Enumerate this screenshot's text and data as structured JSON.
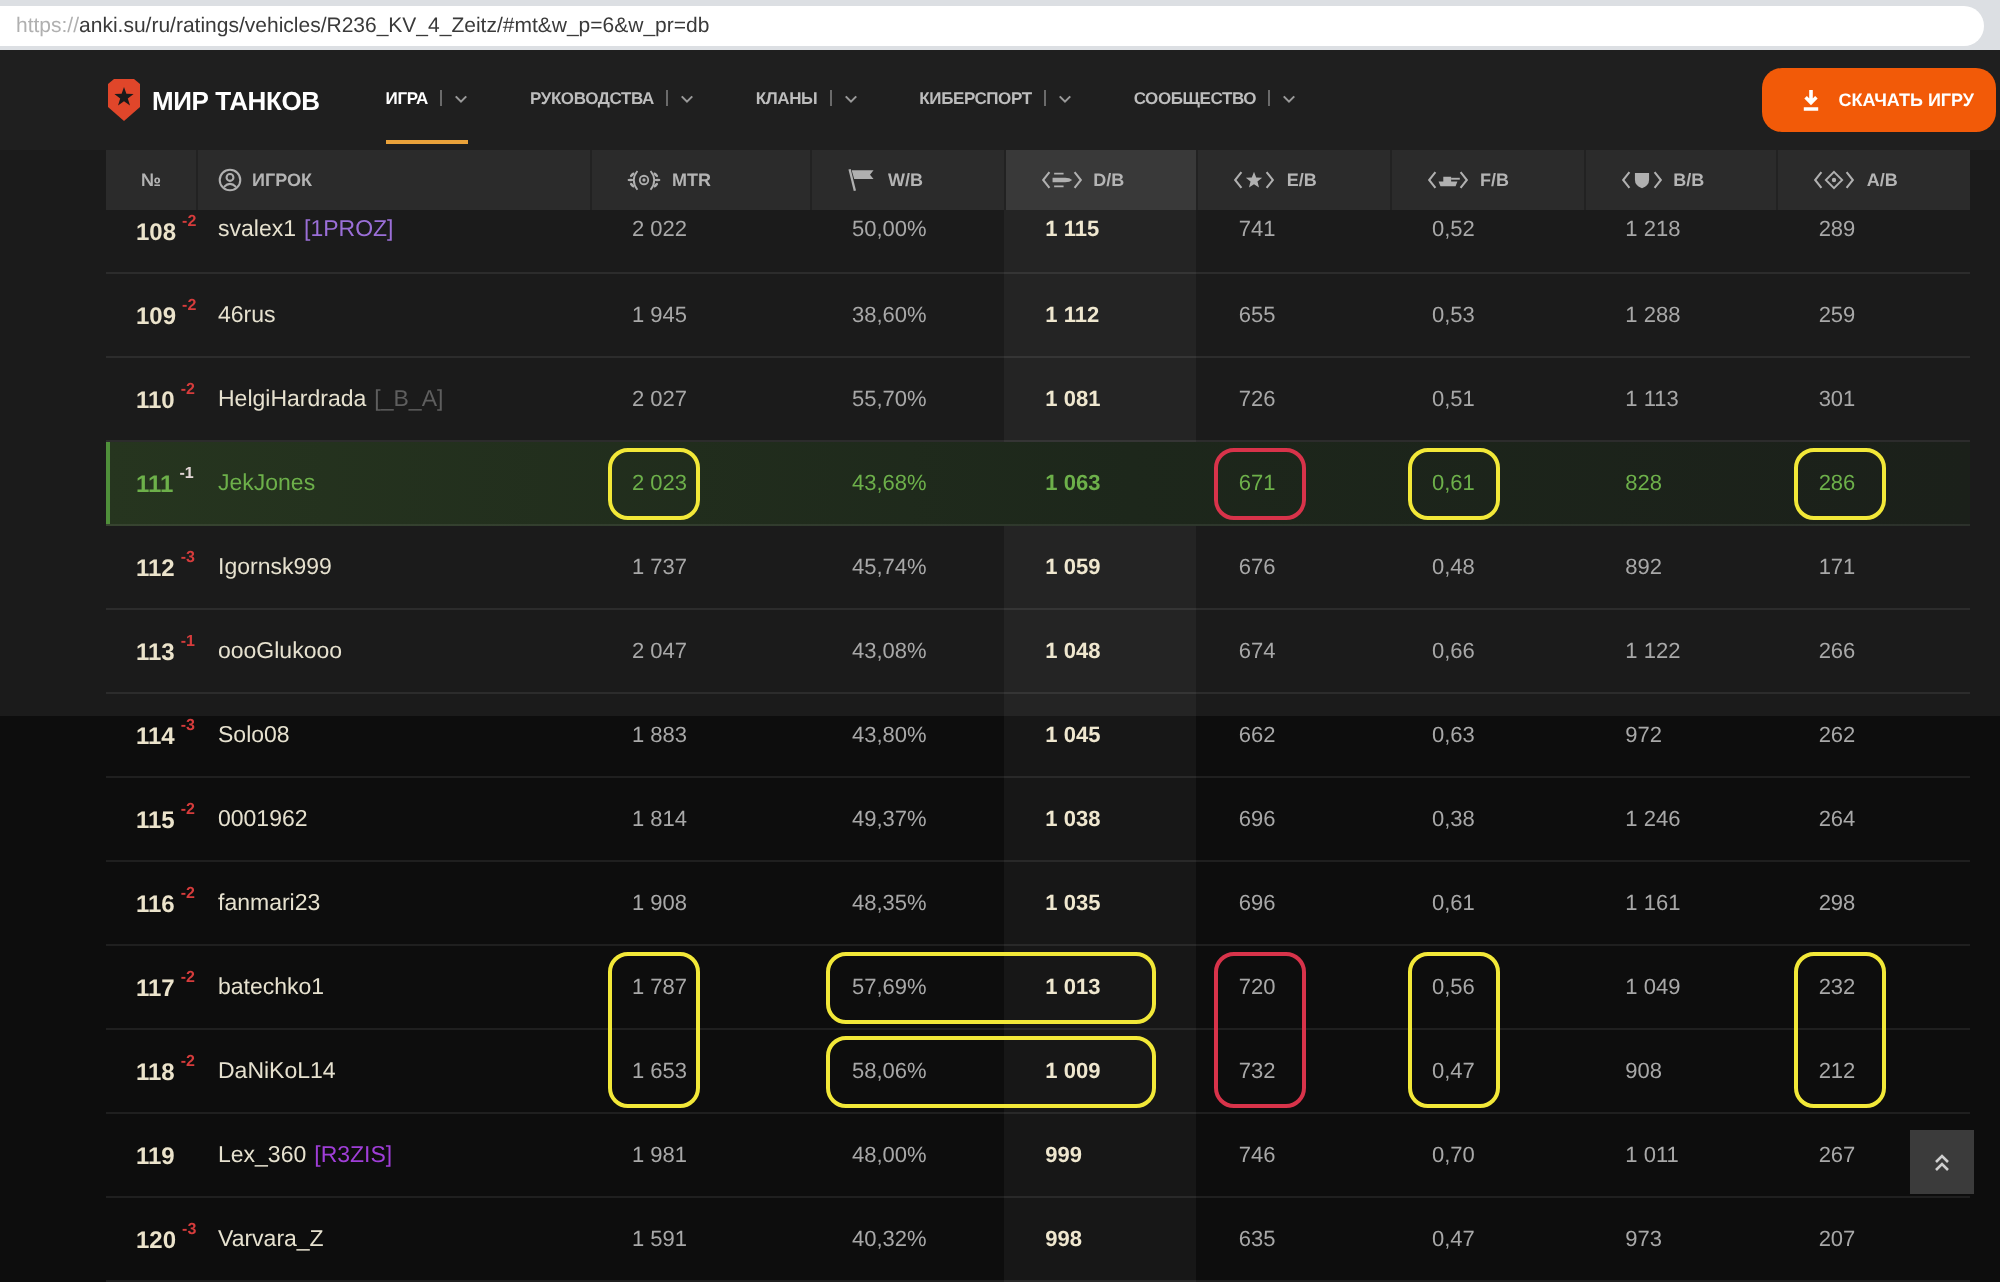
{
  "address_bar": {
    "scheme": "https://",
    "url": "anki.su/ru/ratings/vehicles/R236_KV_4_Zeitz/#mt&w_p=6&w_pr=db"
  },
  "site_header": {
    "logo": "МИР ТАНКОВ",
    "nav": [
      {
        "label": "ИГРА",
        "selected": true
      },
      {
        "label": "РУКОВОДСТВА",
        "selected": false
      },
      {
        "label": "КЛАНЫ",
        "selected": false
      },
      {
        "label": "КИБЕРСПОРТ",
        "selected": false
      },
      {
        "label": "СООБЩЕСТВО",
        "selected": false
      }
    ],
    "download_button": "СКАЧАТЬ ИГРУ"
  },
  "table": {
    "columns": [
      {
        "kind": "rank",
        "label": "№",
        "sorted": false
      },
      {
        "kind": "player",
        "label": "ИГРОК",
        "sorted": false
      },
      {
        "kind": "wreath",
        "label": "MTR",
        "sorted": false
      },
      {
        "kind": "flag",
        "label": "W/B",
        "sorted": false
      },
      {
        "kind": "shell",
        "label": "D/B",
        "sorted": true
      },
      {
        "kind": "star",
        "label": "E/B",
        "sorted": false
      },
      {
        "kind": "tank",
        "label": "F/B",
        "sorted": false
      },
      {
        "kind": "shield",
        "label": "B/B",
        "sorted": false
      },
      {
        "kind": "diamond",
        "label": "A/B",
        "sorted": false
      }
    ],
    "rows": [
      {
        "rank": "108",
        "change": "-2",
        "name": "svalex1",
        "clan": {
          "tag": "[1PROZ]",
          "color": "#9b6fd8"
        },
        "highlighted": false,
        "stats": [
          {
            "value": "2 022"
          },
          {
            "value": "50,00%"
          },
          {
            "value": "1 115"
          },
          {
            "value": "741"
          },
          {
            "value": "0,52"
          },
          {
            "value": "1 218"
          },
          {
            "value": "289"
          }
        ]
      },
      {
        "rank": "109",
        "change": "-2",
        "name": "46rus",
        "highlighted": false,
        "stats": [
          {
            "value": "1 945"
          },
          {
            "value": "38,60%"
          },
          {
            "value": "1 112"
          },
          {
            "value": "655"
          },
          {
            "value": "0,53"
          },
          {
            "value": "1 288"
          },
          {
            "value": "259"
          }
        ]
      },
      {
        "rank": "110",
        "change": "-2",
        "name": "HelgiHardrada",
        "clan": {
          "tag": "[_B_A]",
          "color": "#5e5e5e"
        },
        "highlighted": false,
        "stats": [
          {
            "value": "2 027"
          },
          {
            "value": "55,70%"
          },
          {
            "value": "1 081"
          },
          {
            "value": "726"
          },
          {
            "value": "0,51"
          },
          {
            "value": "1 113"
          },
          {
            "value": "301"
          }
        ]
      },
      {
        "rank": "111",
        "change": "-1",
        "name": "JekJones",
        "highlighted": true,
        "stats": [
          {
            "value": "2 023",
            "outline": {
              "color": "#f2e838",
              "extends_down": false,
              "extends_right": false
            }
          },
          {
            "value": "43,68%"
          },
          {
            "value": "1 063"
          },
          {
            "value": "671",
            "outline": {
              "color": "#d8334a",
              "extends_down": false,
              "extends_right": false
            }
          },
          {
            "value": "0,61",
            "outline": {
              "color": "#f2e838",
              "extends_down": false,
              "extends_right": false
            }
          },
          {
            "value": "828"
          },
          {
            "value": "286",
            "outline": {
              "color": "#f2e838",
              "extends_down": false,
              "extends_right": false
            }
          }
        ]
      },
      {
        "rank": "112",
        "change": "-3",
        "name": "Igornsk999",
        "highlighted": false,
        "stats": [
          {
            "value": "1 737"
          },
          {
            "value": "45,74%"
          },
          {
            "value": "1 059"
          },
          {
            "value": "676"
          },
          {
            "value": "0,48"
          },
          {
            "value": "892"
          },
          {
            "value": "171"
          }
        ]
      },
      {
        "rank": "113",
        "change": "-1",
        "name": "oooGlukooo",
        "highlighted": false,
        "stats": [
          {
            "value": "2 047"
          },
          {
            "value": "43,08%"
          },
          {
            "value": "1 048"
          },
          {
            "value": "674"
          },
          {
            "value": "0,66"
          },
          {
            "value": "1 122"
          },
          {
            "value": "266"
          }
        ]
      },
      {
        "rank": "114",
        "change": "-3",
        "name": "Solo08",
        "highlighted": false,
        "stats": [
          {
            "value": "1 883"
          },
          {
            "value": "43,80%"
          },
          {
            "value": "1 045"
          },
          {
            "value": "662"
          },
          {
            "value": "0,63"
          },
          {
            "value": "972"
          },
          {
            "value": "262"
          }
        ]
      },
      {
        "rank": "115",
        "change": "-2",
        "name": "0001962",
        "highlighted": false,
        "stats": [
          {
            "value": "1 814"
          },
          {
            "value": "49,37%"
          },
          {
            "value": "1 038"
          },
          {
            "value": "696"
          },
          {
            "value": "0,38"
          },
          {
            "value": "1 246"
          },
          {
            "value": "264"
          }
        ]
      },
      {
        "rank": "116",
        "change": "-2",
        "name": "fanmari23",
        "highlighted": false,
        "stats": [
          {
            "value": "1 908"
          },
          {
            "value": "48,35%"
          },
          {
            "value": "1 035"
          },
          {
            "value": "696"
          },
          {
            "value": "0,61"
          },
          {
            "value": "1 161"
          },
          {
            "value": "298"
          }
        ]
      },
      {
        "rank": "117",
        "change": "-2",
        "name": "batechko1",
        "highlighted": false,
        "stats": [
          {
            "value": "1 787",
            "outline": {
              "color": "#f2e838",
              "extends_down": true,
              "extends_right": false
            }
          },
          {
            "value": "57,69%",
            "outline": {
              "color": "#f2e838",
              "extends_down": false,
              "extends_right": true
            }
          },
          {
            "value": "1 013"
          },
          {
            "value": "720",
            "outline": {
              "color": "#d8334a",
              "extends_down": true,
              "extends_right": false
            }
          },
          {
            "value": "0,56",
            "outline": {
              "color": "#f2e838",
              "extends_down": true,
              "extends_right": false
            }
          },
          {
            "value": "1 049"
          },
          {
            "value": "232",
            "outline": {
              "color": "#f2e838",
              "extends_down": true,
              "extends_right": false
            }
          }
        ]
      },
      {
        "rank": "118",
        "change": "-2",
        "name": "DaNiKoL14",
        "highlighted": false,
        "stats": [
          {
            "value": "1 653"
          },
          {
            "value": "58,06%",
            "outline": {
              "color": "#f2e838",
              "extends_down": false,
              "extends_right": true
            }
          },
          {
            "value": "1 009"
          },
          {
            "value": "732"
          },
          {
            "value": "0,47"
          },
          {
            "value": "908"
          },
          {
            "value": "212"
          }
        ]
      },
      {
        "rank": "119",
        "name": "Lex_360",
        "clan": {
          "tag": "[R3ZIS]",
          "color": "#a03ed8"
        },
        "highlighted": false,
        "stats": [
          {
            "value": "1 981"
          },
          {
            "value": "48,00%"
          },
          {
            "value": "999"
          },
          {
            "value": "746"
          },
          {
            "value": "0,70"
          },
          {
            "value": "1 011"
          },
          {
            "value": "267"
          }
        ]
      },
      {
        "rank": "120",
        "change": "-3",
        "name": "Varvara_Z",
        "highlighted": false,
        "stats": [
          {
            "value": "1 591"
          },
          {
            "value": "40,32%"
          },
          {
            "value": "998"
          },
          {
            "value": "635"
          },
          {
            "value": "0,47"
          },
          {
            "value": "973"
          },
          {
            "value": "207"
          }
        ]
      }
    ]
  }
}
